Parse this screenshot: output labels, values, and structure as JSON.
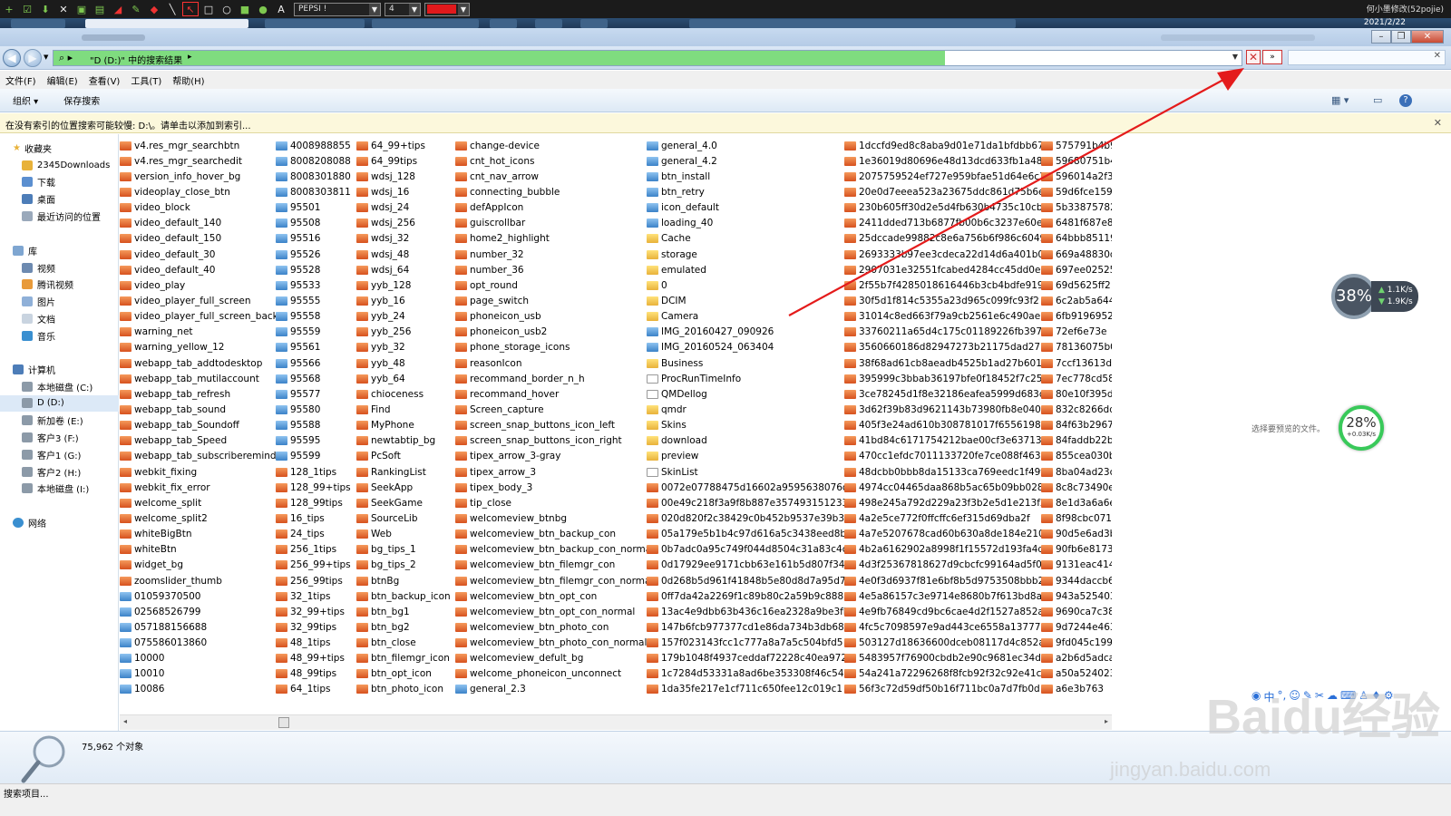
{
  "drawbar": {
    "font_name": "PEPSI !",
    "size_value": "4",
    "pen_color": "#e0191c",
    "credit": "何小墨修改(52pojie)",
    "date": "2021/2/22"
  },
  "address": {
    "path": "\"D (D:)\" 中的搜索结果",
    "progress_percent": 75
  },
  "menus": [
    "文件(F)",
    "编辑(E)",
    "查看(V)",
    "工具(T)",
    "帮助(H)"
  ],
  "commands": [
    "组织 ▾",
    "保存搜索"
  ],
  "infobar": "在没有索引的位置搜索可能较慢: D:\\。请单击以添加到索引...",
  "nav": {
    "favorites_label": "收藏夹",
    "favorites": [
      "2345Downloads",
      "下载",
      "桌面",
      "最近访问的位置"
    ],
    "library_label": "库",
    "library": [
      "视频",
      "腾讯视频",
      "图片",
      "文档",
      "音乐"
    ],
    "computer_label": "计算机",
    "drives": [
      "本地磁盘 (C:)",
      "D (D:)",
      "新加卷 (E:)",
      "客户3 (F:)",
      "客户1 (G:)",
      "客户2 (H:)",
      "本地磁盘 (I:)"
    ],
    "network_label": "网络"
  },
  "files": [
    [
      "v4.res_mgr_searchbtn",
      "v4.res_mgr_searchedit",
      "version_info_hover_bg",
      "videoplay_close_btn",
      "video_block",
      "video_default_140",
      "video_default_150",
      "video_default_30",
      "video_default_40",
      "video_play",
      "video_player_full_screen",
      "video_player_full_screen_back",
      "warning_net",
      "warning_yellow_12",
      "webapp_tab_addtodesktop",
      "webapp_tab_mutilaccount",
      "webapp_tab_refresh",
      "webapp_tab_sound",
      "webapp_tab_Soundoff",
      "webapp_tab_Speed",
      "webapp_tab_subscriberemind",
      "webkit_fixing",
      "webkit_fix_error",
      "welcome_split",
      "welcome_split2",
      "whiteBigBtn",
      "whiteBtn",
      "widget_bg",
      "zoomslider_thumb",
      "01059370500",
      "02568526799",
      "057188156688",
      "075586013860",
      "10000",
      "10010",
      "10086"
    ],
    [
      "4008988855",
      "8008208088",
      "8008301880",
      "8008303811",
      "95501",
      "95508",
      "95516",
      "95526",
      "95528",
      "95533",
      "95555",
      "95558",
      "95559",
      "95561",
      "95566",
      "95568",
      "95577",
      "95580",
      "95588",
      "95595",
      "95599",
      "128_1tips",
      "128_99+tips",
      "128_99tips",
      "16_tips",
      "24_tips",
      "256_1tips",
      "256_99+tips",
      "256_99tips",
      "32_1tips",
      "32_99+tips",
      "32_99tips",
      "48_1tips",
      "48_99+tips",
      "48_99tips",
      "64_1tips"
    ],
    [
      "64_99+tips",
      "64_99tips",
      "wdsj_128",
      "wdsj_16",
      "wdsj_24",
      "wdsj_256",
      "wdsj_32",
      "wdsj_48",
      "wdsj_64",
      "yyb_128",
      "yyb_16",
      "yyb_24",
      "yyb_256",
      "yyb_32",
      "yyb_48",
      "yyb_64",
      "chioceness",
      "Find",
      "MyPhone",
      "newtabtip_bg",
      "PcSoft",
      "RankingList",
      "SeekApp",
      "SeekGame",
      "SourceLib",
      "Web",
      "bg_tips_1",
      "bg_tips_2",
      "btnBg",
      "btn_backup_icon",
      "btn_bg1",
      "btn_bg2",
      "btn_close",
      "btn_filemgr_icon",
      "btn_opt_icon",
      "btn_photo_icon"
    ],
    [
      "change-device",
      "cnt_hot_icons",
      "cnt_nav_arrow",
      "connecting_bubble",
      "defAppIcon",
      "guiscrollbar",
      "home2_highlight",
      "number_32",
      "number_36",
      "opt_round",
      "page_switch",
      "phoneicon_usb",
      "phoneicon_usb2",
      "phone_storage_icons",
      "reasonIcon",
      "recommand_border_n_h",
      "recommand_hover",
      "Screen_capture",
      "screen_snap_buttons_icon_left",
      "screen_snap_buttons_icon_right",
      "tipex_arrow_3-gray",
      "tipex_arrow_3",
      "tipex_body_3",
      "tip_close",
      "welcomeview_btnbg",
      "welcomeview_btn_backup_con",
      "welcomeview_btn_backup_con_normal",
      "welcomeview_btn_filemgr_con",
      "welcomeview_btn_filemgr_con_normal",
      "welcomeview_btn_opt_con",
      "welcomeview_btn_opt_con_normal",
      "welcomeview_btn_photo_con",
      "welcomeview_btn_photo_con_normal",
      "welcomeview_defult_bg",
      "welcome_phoneicon_unconnect",
      "general_2.3"
    ],
    [
      "general_4.0",
      "general_4.2",
      "btn_install",
      "btn_retry",
      "icon_default",
      "loading_40",
      "Cache",
      "storage",
      "emulated",
      "0",
      "DCIM",
      "Camera",
      "IMG_20160427_090926",
      "IMG_20160524_063404",
      "Business",
      "ProcRunTimeInfo",
      "QMDellog",
      "qmdr",
      "Skins",
      "download",
      "preview",
      "SkinList",
      "0072e07788475d16602a9595638076db",
      "00e49c218f3a9f8b887e357493151233",
      "020d820f2c38429c0b452b9537e39b3f",
      "05a179e5b1b4c97d616a5c3438eed8be",
      "0b7adc0a95c749f044d8504c31a83c4c",
      "0d17929ee9171cbb63e161b5d807f340",
      "0d268b5d961f41848b5e80d8d7a95d7b",
      "0ff7da42a2269f1c89b80c2a59b9c888",
      "13ac4e9dbb63b436c16ea2328a9be3fb",
      "147b6fcb977377cd1e86da734b3db682",
      "157f023143fcc1c777a8a7a5c504bfd5",
      "179b1048f4937ceddaf72228c40ea972",
      "1c7284d53331a8ad6be353308f46c545",
      "1da35fe217e1cf711c650fee12c019c1"
    ],
    [
      "1dccfd9ed8c8aba9d01e71da1bfdbb67",
      "1e36019d80696e48d13dcd633fb1a487",
      "2075759524ef727e959bfae51d64e6c3",
      "20e0d7eeea523a23675ddc861d75b6ec",
      "230b605ff30d2e5d4fb630b4735c10cb",
      "2411dded713b6877fb00b6c3237e60e7",
      "25dccade99882c8e6a756b6f986c6049",
      "2693333b97ee3cdeca22d14d6a401b03",
      "2907031e32551fcabed4284cc45dd0e6",
      "2f55b7f4285018616446b3cb4bdfe919",
      "30f5d1f814c5355a23d965c099fc93f2",
      "31014c8ed663f79a9cb2561e6c490ae9",
      "33760211a65d4c175c01189226fb397d",
      "3560660186d82947273b21175dad271c",
      "38f68ad61cb8aeadb4525b1ad27b6011",
      "395999c3bbab36197bfe0f18452f7c25",
      "3ce78245d1f8e32186eafea5999d683d",
      "3d62f39b83d9621143b73980fb8e0408",
      "405f3e24ad610b308781017f65561989",
      "41bd84c6171754212bae00cf3e63713a",
      "470cc1efdc7011133720fe7ce088f463",
      "48dcbb0bbb8da15133ca769eedc1f49f",
      "4974cc04465daa868b5ac65b09bb028c",
      "498e245a792d229a23f3b2e5d1e213f2",
      "4a2e5ce772f0ffcffc6ef315d69dba2f",
      "4a7e5207678cad60b630a8de184e210b",
      "4b2a6162902a8998f1f15572d193fa4d",
      "4d3f25367818627d9cbcfc99164ad5f0",
      "4e0f3d6937f81e6bf8b5d9753508bbb2",
      "4e5a86157c3e9714e8680b7f613bd8a0",
      "4e9fb76849cd9bc6cae4d2f1527a852a",
      "4fc5c7098597e9ad443ce6558a13777",
      "503127d18636600dceb08117d4c852a9",
      "5483957f76900cbdb2e90c9681ec34d0",
      "54a241a72296268f8fcb92f32c92e41c",
      "56f3c72d59df50b16f711bc0a7d7fb0d"
    ],
    [
      "575791b4b9",
      "59680751b4",
      "596014a2f3",
      "59d6fce159",
      "5b33875782",
      "6481f687e8",
      "64bbb85119",
      "669a48830d",
      "697ee02525",
      "69d5625ff2",
      "6c2ab5a644",
      "6fb9196952",
      "72ef6e73e",
      "78136075b0",
      "7ccf13613d",
      "7ec778cd58",
      "80e10f395d",
      "832c8266dd",
      "84f63b2967",
      "84faddb22b",
      "855cea030b",
      "8ba04ad23c",
      "8c8c73490e",
      "8e1d3a6a6e",
      "8f98cbc071",
      "90d5e6ad3b",
      "90fb6e8173",
      "9131eac414",
      "9344daccb6",
      "943a525403",
      "9690ca7c38",
      "9d7244e463",
      "9fd045c199",
      "a2b6d5adca",
      "a50a524023",
      "a6e3b763"
    ]
  ],
  "fileicons": [
    [
      "png",
      29,
      "jpg",
      7
    ],
    [
      "jpg",
      21,
      "png",
      15
    ],
    [
      "png",
      36
    ],
    [
      "png",
      35,
      "jpg",
      1
    ],
    [
      "jpg",
      6,
      "fold",
      6,
      "jpg",
      2,
      "fold",
      1,
      "doc",
      1,
      "doc",
      1,
      "fold",
      1,
      "fold",
      3,
      "doc",
      1,
      "png",
      14
    ],
    [
      "png",
      36
    ],
    [
      "png",
      36
    ]
  ],
  "status": {
    "count": "75,962 个对象",
    "searching": "搜索项目...",
    "preview_hint": "选择要预览的文件。"
  },
  "monitor1": {
    "percent": "38%",
    "up": "1.1K/s",
    "down": "1.9K/s"
  },
  "monitor2": {
    "percent": "28%",
    "speed": "+0.03K/s"
  },
  "watermark": {
    "brand": "Baidu经验",
    "url": "jingyan.baidu.com"
  },
  "colors": {
    "progress": "#7fdc7f",
    "arrow": "#e41b1b",
    "info_bg": "#fcf8dc"
  }
}
